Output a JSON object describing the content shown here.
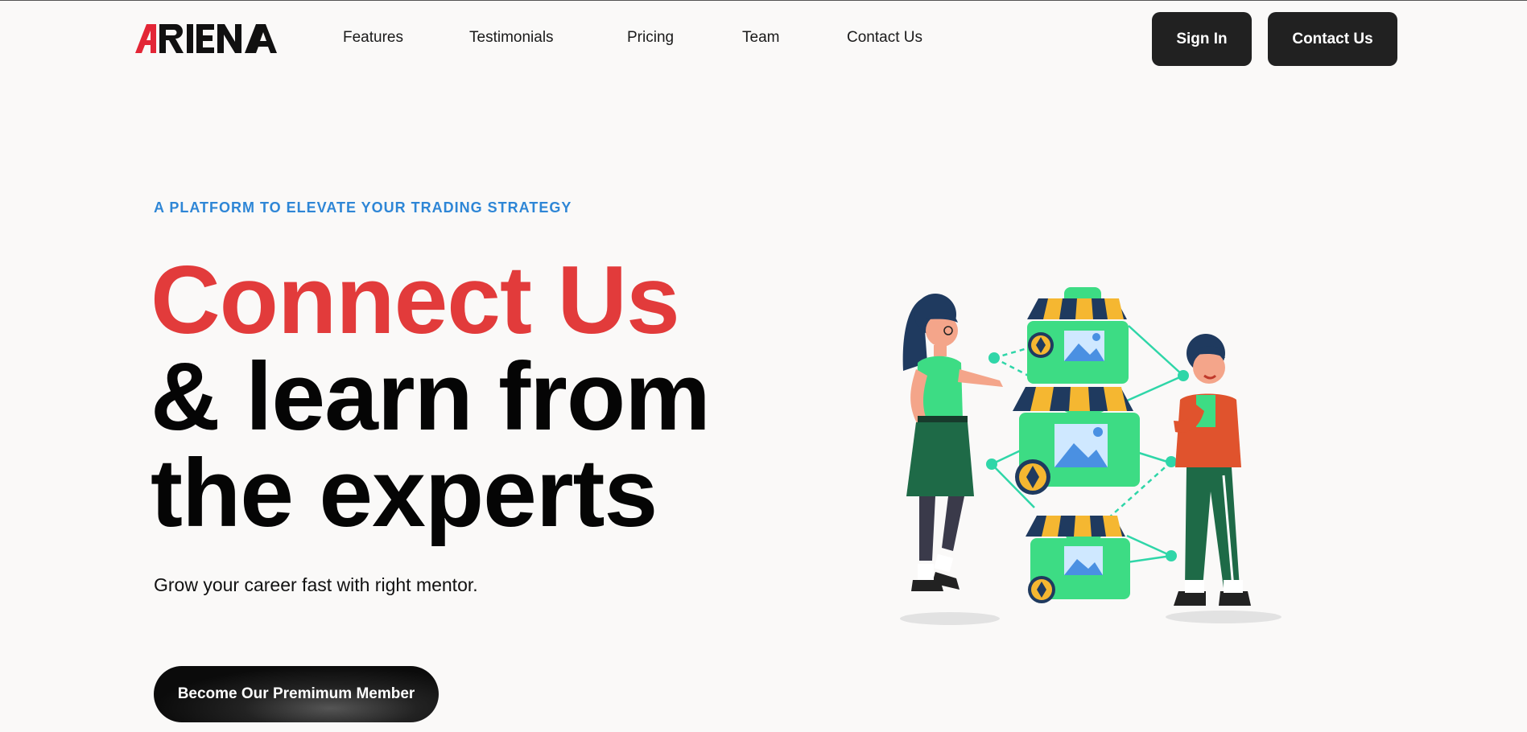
{
  "header": {
    "logo_text": "ARENA",
    "nav": [
      "Features",
      "Testimonials",
      "Pricing",
      "Team",
      "Contact Us"
    ],
    "signin_label": "Sign In",
    "contact_label": "Contact Us"
  },
  "hero": {
    "kicker": "A PLATFORM TO ELEVATE YOUR TRADING STRATEGY",
    "headline_red": "Connect Us",
    "headline_line2": "& learn from",
    "headline_line3": "the experts",
    "subtext": "Grow your career fast with right mentor.",
    "cta_label": "Become Our Premimum Member"
  },
  "colors": {
    "accent_red": "#e23b3b",
    "kicker_blue": "#2e86d6",
    "button_dark": "#212121",
    "background": "#faf9f8"
  },
  "icons": {
    "illustration": "marketplace-people-illustration"
  }
}
